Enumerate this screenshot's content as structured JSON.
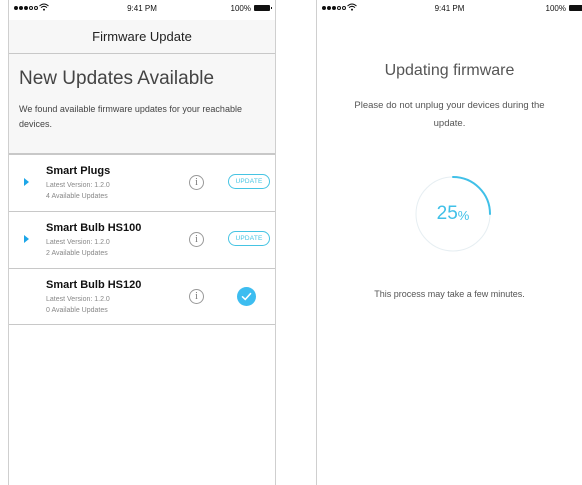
{
  "left_screen": {
    "statusbar": {
      "time": "9:41 PM",
      "battery": "100%"
    },
    "nav_title": "Firmware Update",
    "header": {
      "title": "New Updates Available",
      "description": "We found available firmware updates for your reachable devices."
    },
    "devices": [
      {
        "name": "Smart Plugs",
        "version": "Latest Version: 1.2.0",
        "available": "4 Available Updates",
        "status": "update",
        "button_label": "UPDATE"
      },
      {
        "name": "Smart Bulb HS100",
        "version": "Latest Version: 1.2.0",
        "available": "2 Available Updates",
        "status": "update",
        "button_label": "UPDATE"
      },
      {
        "name": "Smart Bulb HS120",
        "version": "Latest Version: 1.2.0",
        "available": "0 Available Updates",
        "status": "done"
      }
    ],
    "info_glyph": "i"
  },
  "right_screen": {
    "statusbar": {
      "time": "9:41 PM",
      "battery": "100%"
    },
    "title": "Updating firmware",
    "description": "Please do not unplug your devices during the update.",
    "progress": {
      "value": 25,
      "number": "25",
      "unit": "%"
    },
    "note": "This process may take a few minutes."
  },
  "colors": {
    "accent": "#3dbdf0",
    "background_header": "#f7f7f7",
    "divider": "#c8c8c8"
  },
  "icons": [
    "wifi-icon",
    "battery-icon",
    "expand-arrow-icon",
    "info-icon",
    "check-icon"
  ]
}
